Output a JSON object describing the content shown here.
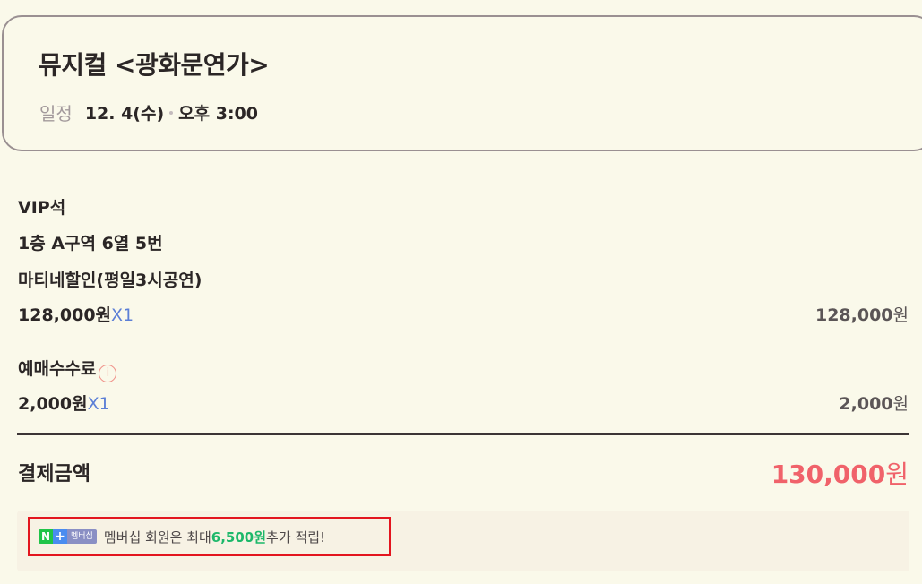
{
  "show": {
    "title": "뮤지컬 <광화문연가>",
    "schedule_label": "일정",
    "date": "12. 4(수)",
    "time": "오후 3:00"
  },
  "ticket": {
    "grade": "VIP석",
    "seat": "1층 A구역 6열 5번",
    "discount": "마티네할인(평일3시공연)",
    "unit_price": "128,000원",
    "quantity": "X1",
    "subtotal_number": "128,000",
    "currency": "원"
  },
  "fee": {
    "label": "예매수수료",
    "info_icon": "info-circle-icon",
    "info_glyph": "i",
    "unit_price": "2,000원",
    "quantity": "X1",
    "subtotal_number": "2,000",
    "currency": "원"
  },
  "total": {
    "label": "결제금액",
    "amount_number": "130,000",
    "currency": "원"
  },
  "membership": {
    "badge_n": "N",
    "badge_plus": "+",
    "badge_tag": "멤버십",
    "text_before": "멤버십 회원은 최대 ",
    "points": "6,500원",
    "text_after": " 추가 적립!"
  },
  "colors": {
    "background": "#faf9ea",
    "accent_total": "#f0626a",
    "quantity_blue": "#5c7fd6",
    "points_green": "#1db86a",
    "highlight_border": "#e3151e"
  }
}
